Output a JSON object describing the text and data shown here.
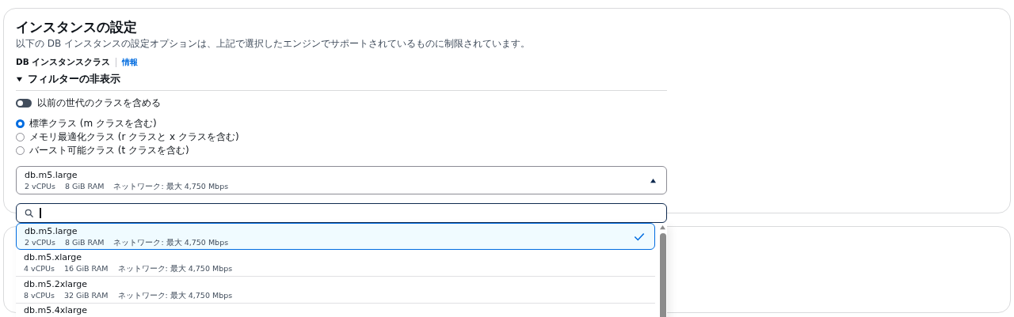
{
  "section": {
    "title": "インスタンスの設定",
    "description": "以下の DB インスタンスの設定オプションは、上記で選択したエンジンでサポートされているものに制限されています。",
    "field_label": "DB インスタンスクラス",
    "info_link": "情報",
    "filter_toggle": {
      "label": "フィルターの非表示",
      "expanded": true
    },
    "previous_generation": {
      "label": "以前の世代のクラスを含める",
      "on": false
    },
    "class_options": [
      {
        "label": "標準クラス (m クラスを含む)",
        "selected": true
      },
      {
        "label": "メモリ最適化クラス (r クラスと x クラスを含む)",
        "selected": false
      },
      {
        "label": "バースト可能クラス (t クラスを含む)",
        "selected": false
      }
    ],
    "select": {
      "name": "db.m5.large",
      "specs": [
        "2 vCPUs",
        "8 GiB RAM",
        "ネットワーク: 最大 4,750 Mbps"
      ],
      "expanded": true
    }
  },
  "dropdown": {
    "options": [
      {
        "name": "db.m5.large",
        "specs": [
          "2 vCPUs",
          "8 GiB RAM",
          "ネットワーク: 最大 4,750 Mbps"
        ],
        "selected": true
      },
      {
        "name": "db.m5.xlarge",
        "specs": [
          "4 vCPUs",
          "16 GiB RAM",
          "ネットワーク: 最大 4,750 Mbps"
        ],
        "selected": false
      },
      {
        "name": "db.m5.2xlarge",
        "specs": [
          "8 vCPUs",
          "32 GiB RAM",
          "ネットワーク: 最大 4,750 Mbps"
        ],
        "selected": false
      },
      {
        "name": "db.m5.4xlarge",
        "selected": false
      }
    ]
  }
}
